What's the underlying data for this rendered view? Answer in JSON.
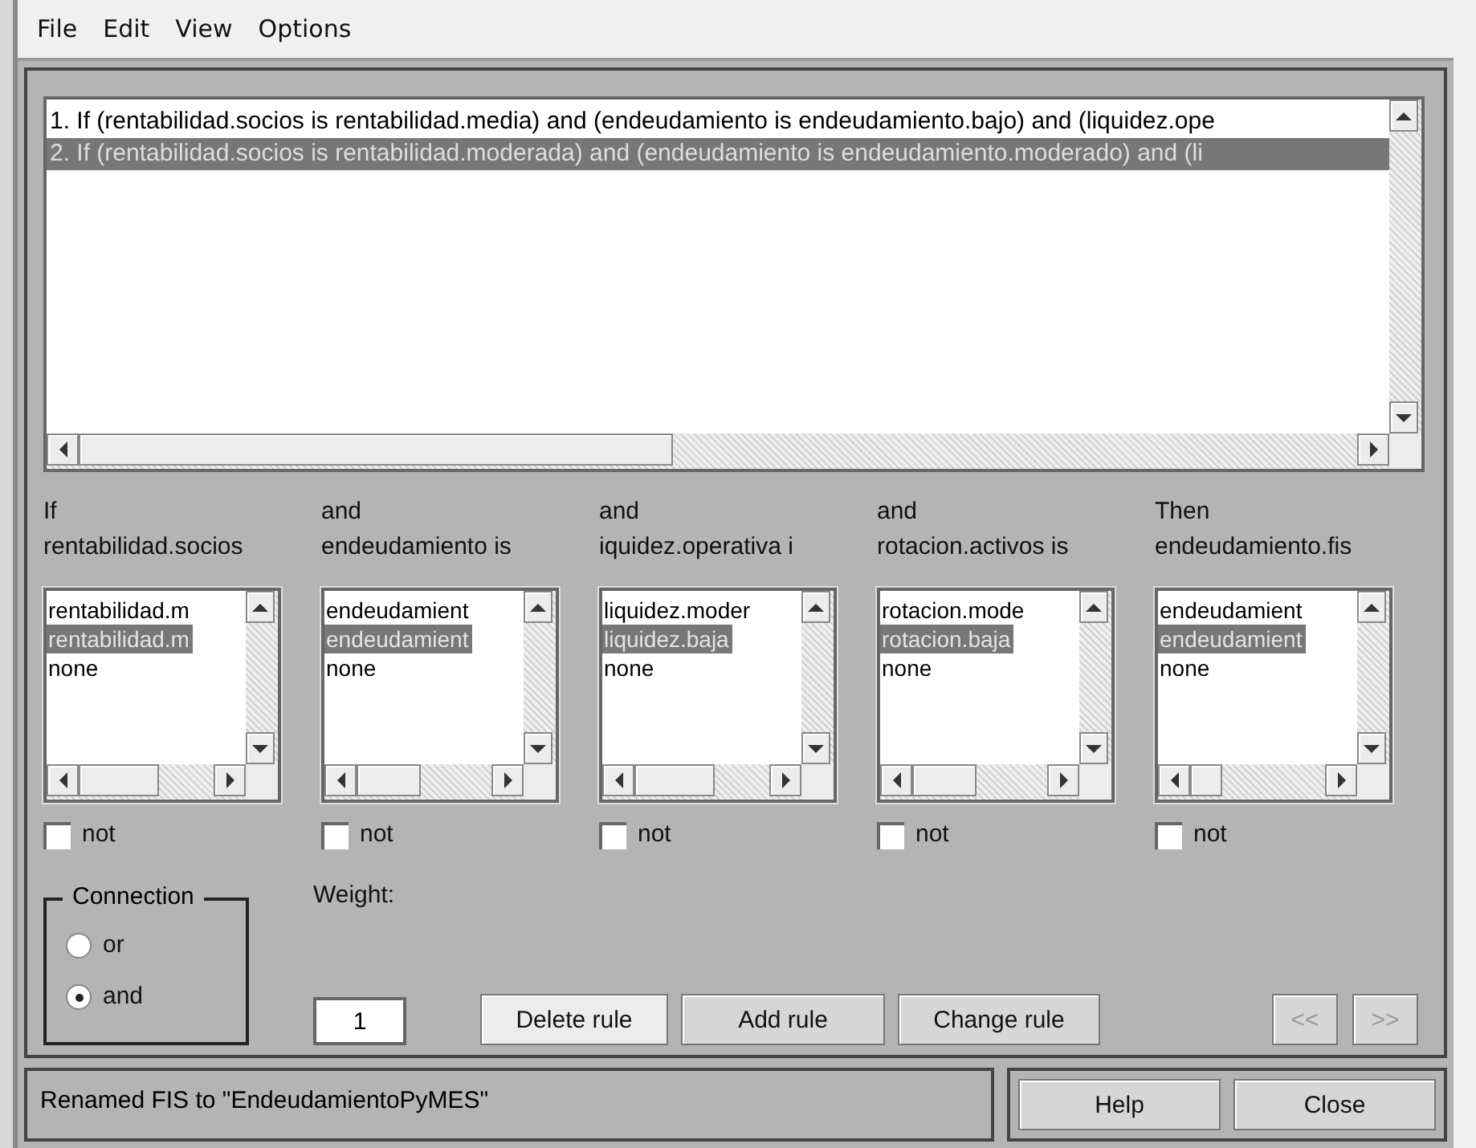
{
  "menu": [
    "File",
    "Edit",
    "View",
    "Options"
  ],
  "rules": [
    {
      "text": "1. If (rentabilidad.socios is rentabilidad.media) and (endeudamiento is endeudamiento.bajo) and (liquidez.ope",
      "selected": false
    },
    {
      "text": "2. If (rentabilidad.socios is rentabilidad.moderada) and (endeudamiento is endeudamiento.moderado) and (li",
      "selected": true
    }
  ],
  "columns": [
    {
      "connector": "If",
      "variable": "rentabilidad.socios",
      "not_label": "not",
      "not": false,
      "items": [
        {
          "text": "rentabilidad.m",
          "selected": false
        },
        {
          "text": "rentabilidad.m",
          "selected": true
        },
        {
          "text": "none",
          "selected": false
        }
      ]
    },
    {
      "connector": "and",
      "variable": "endeudamiento is",
      "not_label": "not",
      "not": false,
      "items": [
        {
          "text": "endeudamient",
          "selected": false
        },
        {
          "text": "endeudamient",
          "selected": true
        },
        {
          "text": "none",
          "selected": false
        }
      ]
    },
    {
      "connector": "and",
      "variable": "iquidez.operativa i",
      "not_label": "not",
      "not": false,
      "items": [
        {
          "text": "liquidez.moder",
          "selected": false
        },
        {
          "text": "liquidez.baja",
          "selected": true
        },
        {
          "text": "none",
          "selected": false
        }
      ]
    },
    {
      "connector": "and",
      "variable": "rotacion.activos is",
      "not_label": "not",
      "not": false,
      "items": [
        {
          "text": "rotacion.mode",
          "selected": false
        },
        {
          "text": "rotacion.baja",
          "selected": true
        },
        {
          "text": "none",
          "selected": false
        }
      ]
    },
    {
      "connector": "Then",
      "variable": "endeudamiento.fis",
      "not_label": "not",
      "not": false,
      "items": [
        {
          "text": "endeudamient",
          "selected": false
        },
        {
          "text": "endeudamient",
          "selected": true
        },
        {
          "text": "none",
          "selected": false
        }
      ]
    }
  ],
  "connection": {
    "title": "Connection",
    "options": [
      {
        "label": "or",
        "selected": false
      },
      {
        "label": "and",
        "selected": true
      }
    ]
  },
  "weight": {
    "label": "Weight:",
    "value": "1"
  },
  "buttons": [
    {
      "label": "Delete rule",
      "disabled": false
    },
    {
      "label": "Add rule",
      "disabled": false
    },
    {
      "label": "Change rule",
      "disabled": false
    }
  ],
  "nav_buttons": [
    {
      "label": "<<",
      "disabled": true
    },
    {
      "label": ">>",
      "disabled": true
    }
  ],
  "status": "Renamed FIS to \"EndeudamientoPyMES\"",
  "footer_buttons": [
    {
      "label": "Help"
    },
    {
      "label": "Close"
    }
  ]
}
